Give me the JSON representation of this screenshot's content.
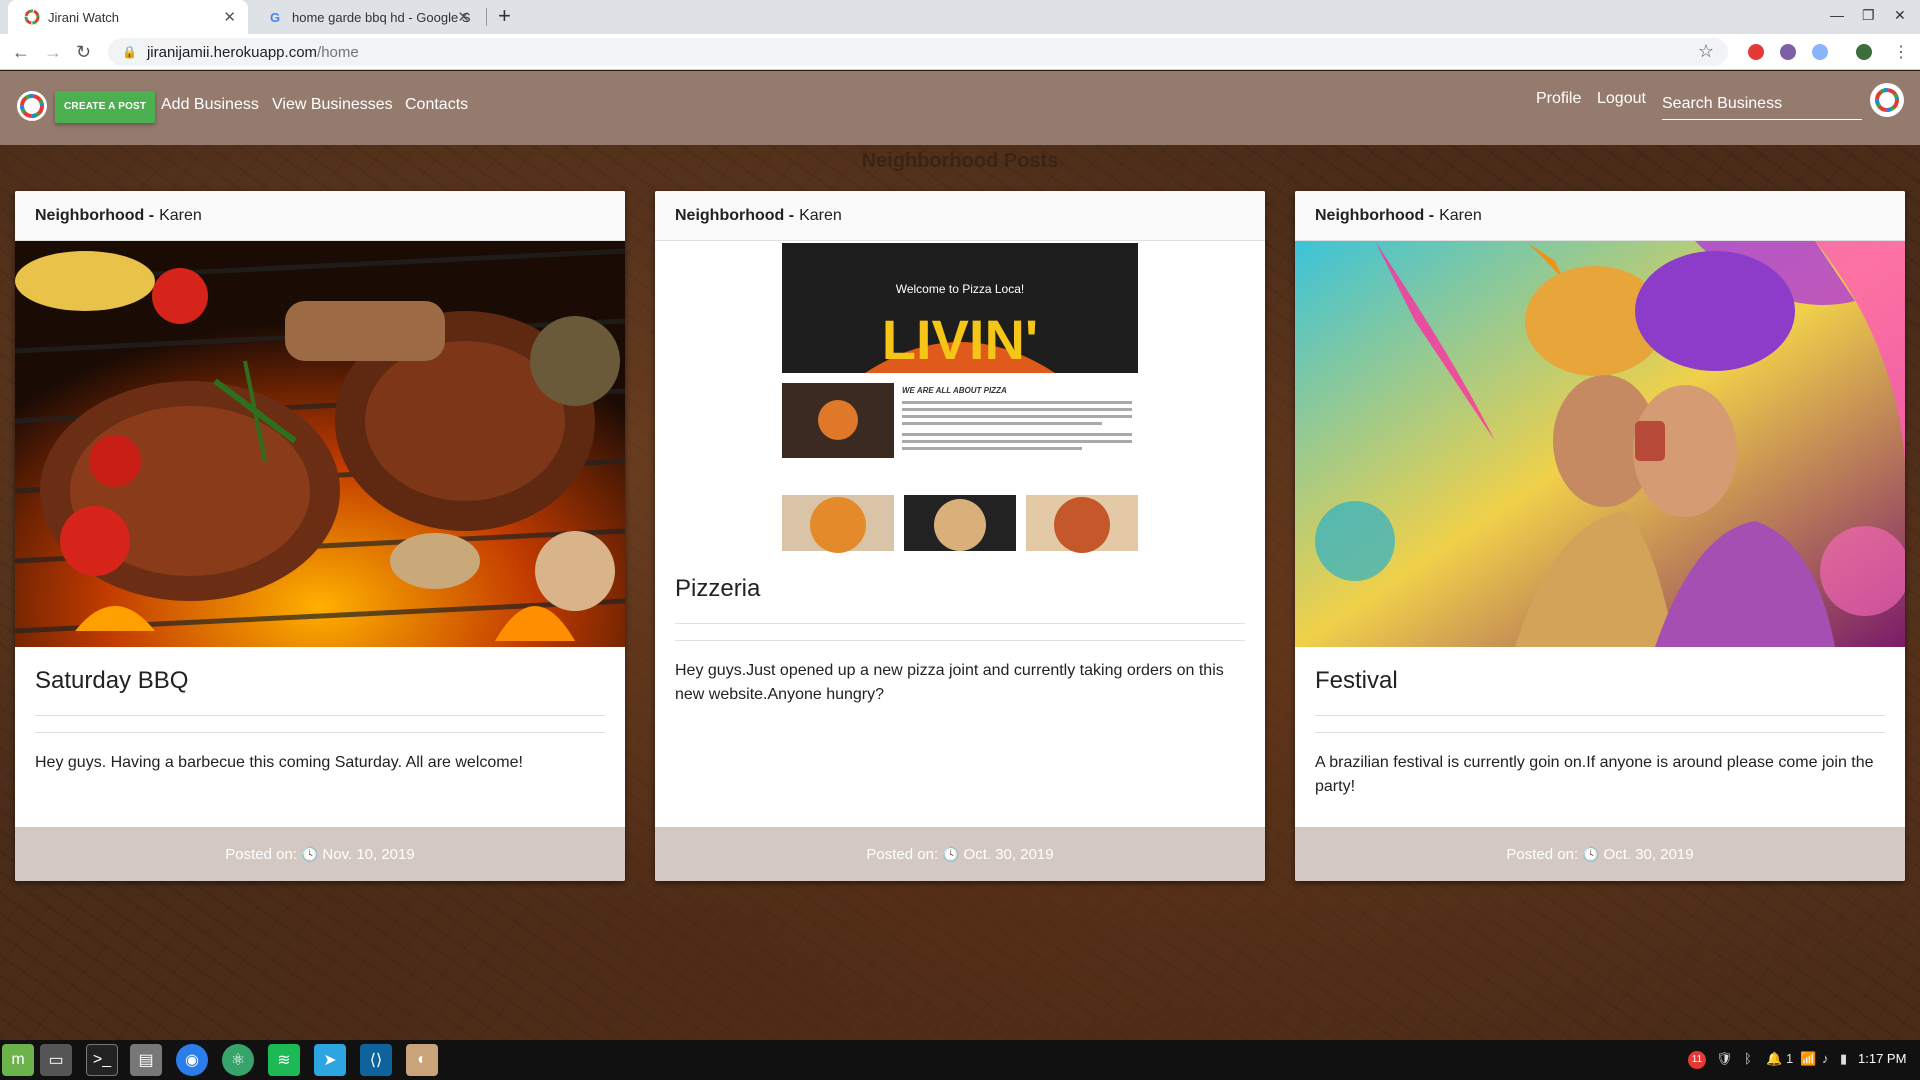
{
  "browser": {
    "tabs": [
      {
        "title": "Jirani Watch",
        "active": true
      },
      {
        "title": "home garde bbq hd - Google Se",
        "active": false
      }
    ],
    "url_host": "jiranijamii.herokuapp.com",
    "url_path": "/home"
  },
  "navbar": {
    "create_post": "CREATE A POST",
    "links": [
      "Add Business",
      "View Businesses",
      "Contacts"
    ],
    "profile": "Profile",
    "logout": "Logout",
    "search_placeholder": "Search Business"
  },
  "section_title": "Neighborhood Posts",
  "posts": [
    {
      "neighborhood_label": "Neighborhood -",
      "neighborhood": "Karen",
      "title": "Saturday BBQ",
      "text": "Hey guys. Having a barbecue this coming Saturday. All are welcome!",
      "posted_label": "Posted on:",
      "date": "Nov. 10, 2019"
    },
    {
      "neighborhood_label": "Neighborhood -",
      "neighborhood": "Karen",
      "title": "Pizzeria",
      "text": "Hey guys.Just opened up a new pizza joint and currently taking orders on this new website.Anyone hungry?",
      "posted_label": "Posted on:",
      "date": "Oct. 30, 2019",
      "image_text": {
        "welcome": "Welcome to Pizza Loca!",
        "banner": "LIVIN'",
        "heading": "WE ARE ALL ABOUT PIZZA"
      }
    },
    {
      "neighborhood_label": "Neighborhood -",
      "neighborhood": "Karen",
      "title": "Festival",
      "text": "A brazilian festival is currently goin on.If anyone is around please come join the party!",
      "posted_label": "Posted on:",
      "date": "Oct. 30, 2019"
    }
  ],
  "taskbar": {
    "time": "1:17 PM",
    "tray_count": "1",
    "badge": "11"
  },
  "colors": {
    "navbar": "#957b6e",
    "create_button": "#4caf50",
    "card_footer": "#d4c8c3"
  }
}
